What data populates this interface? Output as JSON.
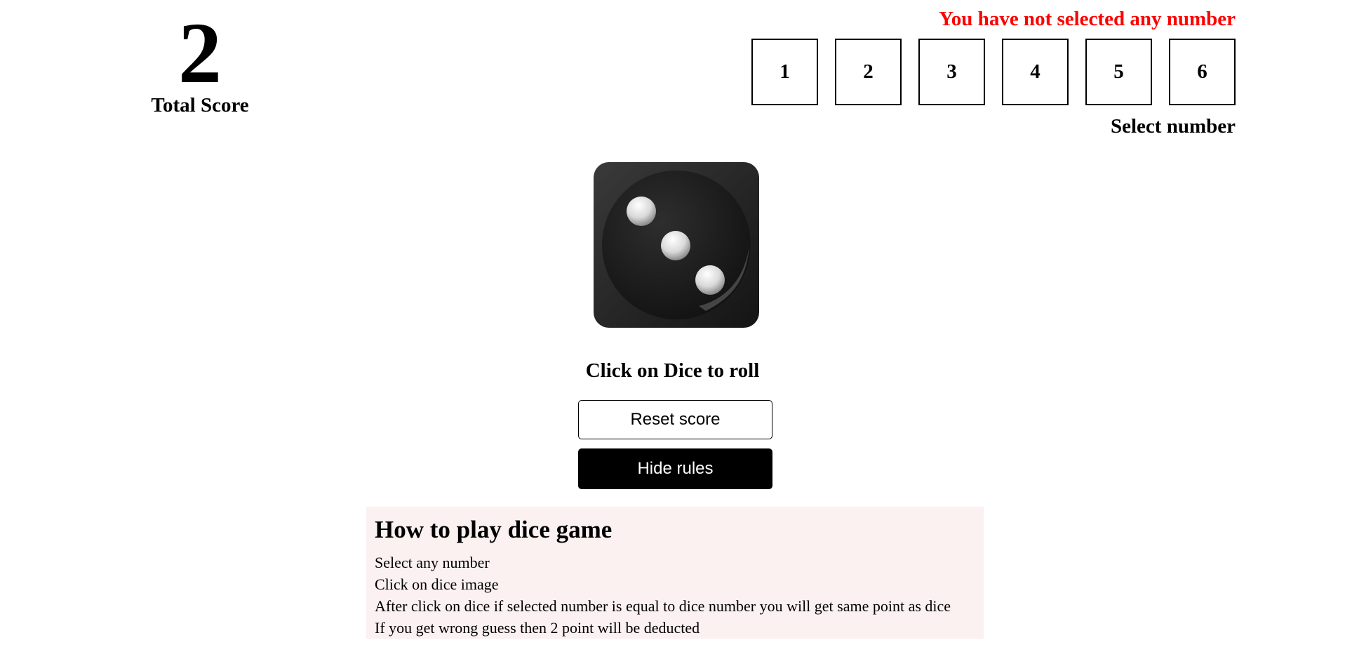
{
  "score": {
    "value": "2",
    "label": "Total Score"
  },
  "selection": {
    "error": "You have not selected any number",
    "numbers": [
      "1",
      "2",
      "3",
      "4",
      "5",
      "6"
    ],
    "label": "Select number"
  },
  "dice": {
    "face_value": 3,
    "instruction": "Click on Dice to roll"
  },
  "buttons": {
    "reset_label": "Reset score",
    "hide_rules_label": "Hide rules"
  },
  "rules": {
    "title": "How to play dice game",
    "lines": [
      "Select any number",
      "Click on dice image",
      "After click on dice if selected number is equal to dice number you will get same point as dice",
      "If you get wrong guess then 2 point will be deducted"
    ]
  },
  "colors": {
    "error": "#ff0000",
    "rules_bg": "#fbf1f1",
    "primary_button": "#000000"
  }
}
